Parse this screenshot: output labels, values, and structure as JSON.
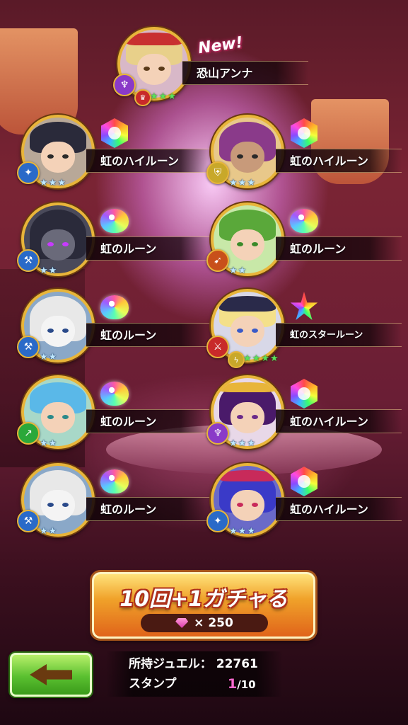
{
  "featured": {
    "name": "恐山アンナ",
    "badge": "New!",
    "element_icon": "cane-icon",
    "rarity_icon": "crown-icon",
    "stars": 3,
    "star_color": "green"
  },
  "results": [
    {
      "item": "虹のハイルーン",
      "rune": "hex-rune",
      "element_icon": "whirlwind-icon",
      "element_color": "#2a6ac8",
      "stars": 3,
      "hair": "#2a2a3a"
    },
    {
      "item": "虹のハイルーン",
      "rune": "hex-rune",
      "element_icon": "shield-icon",
      "element_color": "#c8a82a",
      "stars": 3,
      "hair": "#8a3a8a"
    },
    {
      "item": "虹のルーン",
      "rune": "blob-rune",
      "element_icon": "axe-icon",
      "element_color": "#2a6ac8",
      "stars": 2,
      "hair": "#3a3a4a"
    },
    {
      "item": "虹のルーン",
      "rune": "blob-rune",
      "element_icon": "bow-icon",
      "element_color": "#c8501a",
      "stars": 2,
      "hair": "#5aa83a"
    },
    {
      "item": "虹のルーン",
      "rune": "blob-rune",
      "element_icon": "axe-icon",
      "element_color": "#2a6ac8",
      "stars": 2,
      "hair": "#e8e8e8"
    },
    {
      "item": "虹のスタールーン",
      "rune": "star-rune",
      "element_icon": "sword-icon",
      "element_color": "#c82a2a",
      "stars": 4,
      "hair": "#f4e08a",
      "extra_icon": "lightning-icon"
    },
    {
      "item": "虹のルーン",
      "rune": "blob-rune",
      "element_icon": "spear-icon",
      "element_color": "#2aa83a",
      "stars": 2,
      "hair": "#5ab8e8"
    },
    {
      "item": "虹のハイルーン",
      "rune": "hex-rune",
      "element_icon": "cane-icon",
      "element_color": "#8a3ac8",
      "stars": 3,
      "hair": "#4a1a6a"
    },
    {
      "item": "虹のルーン",
      "rune": "blob-rune",
      "element_icon": "axe-icon",
      "element_color": "#2a6ac8",
      "stars": 2,
      "hair": "#e8e8e8"
    },
    {
      "item": "虹のハイルーン",
      "rune": "hex-rune",
      "element_icon": "whirlwind-icon",
      "element_color": "#2a6ac8",
      "stars": 3,
      "hair": "#3a3ac8"
    }
  ],
  "gacha": {
    "label": "10回+1ガチャる",
    "cost_icon": "gem-icon",
    "cost": "× 250"
  },
  "footer": {
    "jewel_label": "所持ジュエル：",
    "jewel_value": "22761",
    "stamp_label": "スタンプ",
    "stamp_current": "1",
    "stamp_max": "/10"
  },
  "back_button_icon": "back-arrow-icon"
}
